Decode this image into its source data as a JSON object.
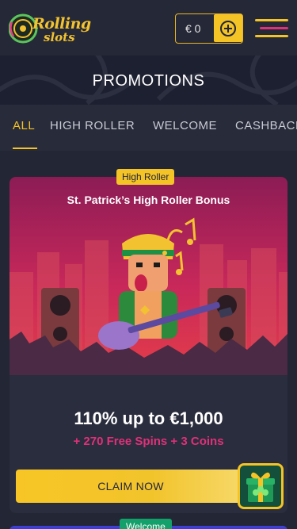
{
  "header": {
    "logo_line1": "Rolling",
    "logo_line2": "slots",
    "balance": "€ 0"
  },
  "page_title": "PROMOTIONS",
  "tabs": [
    {
      "label": "ALL",
      "active": true
    },
    {
      "label": "HIGH ROLLER",
      "active": false
    },
    {
      "label": "WELCOME",
      "active": false
    },
    {
      "label": "CASHBACK",
      "active": false
    }
  ],
  "promo": {
    "badge": "High Roller",
    "title": "St. Patrick’s High Roller Bonus",
    "headline": "110% up to €1,000",
    "subline": "+ 270 Free Spins + 3 Coins",
    "cta": "CLAIM NOW"
  },
  "next_promo": {
    "badge": "Welcome"
  },
  "colors": {
    "accent": "#f4c326",
    "background": "#232634",
    "promo_pink": "#e0307a",
    "welcome_green": "#14a06a"
  },
  "icons": {
    "deposit": "plus-circle-icon",
    "menu": "hamburger-icon",
    "gift": "gift-box-icon"
  }
}
